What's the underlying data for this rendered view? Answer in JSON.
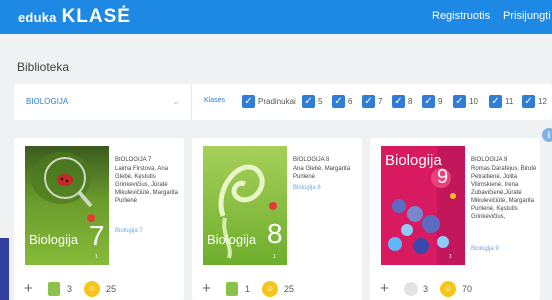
{
  "header": {
    "logo_small": "eduka",
    "logo_big": "KLASĖ",
    "nav": [
      {
        "label": "Registruotis"
      },
      {
        "label": "Prisijungti"
      }
    ]
  },
  "page": {
    "title": "Biblioteka"
  },
  "filters": {
    "subject": "BIOLOGIJA",
    "classes_label": "Klasės",
    "checkboxes": [
      {
        "label": "Pradinukai",
        "checked": true
      },
      {
        "label": "5",
        "checked": true
      },
      {
        "label": "6",
        "checked": true
      },
      {
        "label": "7",
        "checked": true
      },
      {
        "label": "8",
        "checked": true
      },
      {
        "label": "9",
        "checked": true
      },
      {
        "label": "10",
        "checked": true
      },
      {
        "label": "11",
        "checked": true
      },
      {
        "label": "12",
        "checked": true
      }
    ]
  },
  "books": [
    {
      "title": "BIOLOGIJA 7",
      "authors": "Laima Firstova, Ana Glebė, Kęstutis Grinkevičius, Jūratė Mikulevičiūtė, Margarita Purlienė",
      "link": "Biologija 7",
      "cover_title": "Biologija",
      "cover_number": "7",
      "resources": "3",
      "points": "25"
    },
    {
      "title": "BIOLOGIJA 8",
      "authors": "Ana Glebė, Margarita Purlienė",
      "link": "Biologija 8",
      "cover_title": "Biologija",
      "cover_number": "8",
      "resources": "1",
      "points": "25"
    },
    {
      "title": "BIOLOGIJA 9",
      "authors": "Romas Darafėjus, Birutė Petraitienė, Jolita Vilimskienė, Irena Zubavičienė,Jūratė Mikulevičiūtė, Margarita Purlienė, Kęstutis Grinkevičius,",
      "link": "Biologija 9",
      "cover_title": "Biologija",
      "cover_number": "9",
      "resources": "3",
      "points": "70"
    }
  ],
  "colors": {
    "header": "#1e88e5",
    "accent": "#2f7dd6",
    "cover_green": "#7cb342",
    "cover_red": "#d81b60",
    "coin": "#f5c518"
  }
}
